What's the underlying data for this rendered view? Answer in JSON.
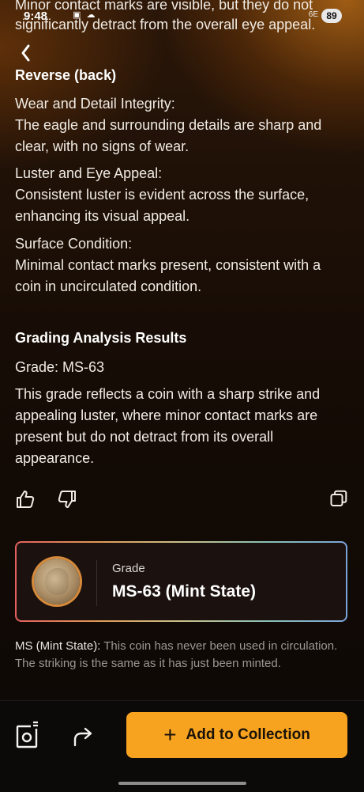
{
  "status_bar": {
    "time": "9:48",
    "icons": "▣ ☁",
    "signal": "6E",
    "battery": "89"
  },
  "cut_text": "Minor contact marks are visible, but they do not significantly detract from the overall eye appeal.",
  "reverse": {
    "heading": "Reverse (back)",
    "sections": [
      {
        "title": "Wear and Detail Integrity:",
        "body": "The eagle and surrounding details are sharp and clear, with no signs of wear."
      },
      {
        "title": "Luster and Eye Appeal:",
        "body": "Consistent luster is evident across the surface, enhancing its visual appeal."
      },
      {
        "title": "Surface Condition:",
        "body": "Minimal contact marks present, consistent with a coin in uncirculated condition."
      }
    ]
  },
  "results": {
    "heading": "Grading Analysis Results",
    "grade_line": "Grade: MS-63",
    "description": "This grade reflects a coin with a sharp strike and appealing luster, where minor contact marks are present but do not detract from its overall appearance."
  },
  "grade_card": {
    "label": "Grade",
    "value": "MS-63 (Mint State)"
  },
  "ms_note": {
    "term": "MS (Mint State):",
    "text": " This coin has never been used in circulation. The striking is the same as it has just been minted."
  },
  "bottom": {
    "add_label": "Add to Collection",
    "add_icon": "+"
  },
  "colors": {
    "accent": "#f7a31f",
    "background": "#120a05"
  }
}
